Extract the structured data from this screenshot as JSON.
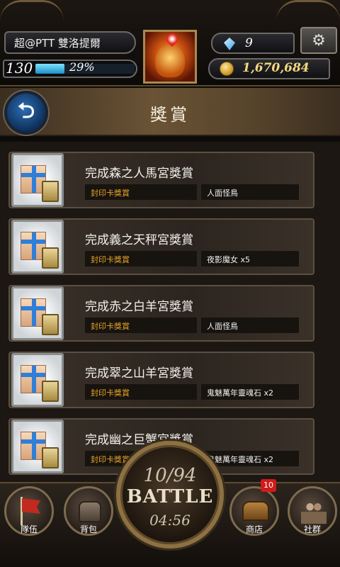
{
  "header": {
    "player_name": "超@PTT 雙洛提爾",
    "level": "130",
    "exp_percent": "29%",
    "exp_fraction": 0.29,
    "gems": "9",
    "coins": "1,670,684",
    "avatar_icon": "fire-lion-avatar",
    "settings_icon": "gears-icon"
  },
  "title_bar": {
    "back_icon": "back-arrow-icon",
    "title": "獎賞"
  },
  "rewards": [
    {
      "name": "完成森之人馬宮獎賞",
      "type": "封印卡獎賞",
      "item": "人面怪鳥"
    },
    {
      "name": "完成義之天秤宮獎賞",
      "type": "封印卡獎賞",
      "item": "夜影魔女 x5"
    },
    {
      "name": "完成赤之白羊宮獎賞",
      "type": "封印卡獎賞",
      "item": "人面怪鳥"
    },
    {
      "name": "完成翠之山羊宮獎賞",
      "type": "封印卡獎賞",
      "item": "鬼魅萬年靈魂石 x2"
    },
    {
      "name": "完成幽之巨蟹宮獎賞",
      "type": "封印卡獎賞",
      "item": "鬼魅萬年靈魂石 x2"
    }
  ],
  "bottom_nav": {
    "team": "隊伍",
    "bag": "背包",
    "shop": "商店",
    "shop_badge": "10",
    "community": "社群",
    "battle_count": "10/94",
    "battle_label": "BATTLE",
    "battle_timer": "04:56"
  },
  "colors": {
    "accent_gold": "#e9a627",
    "exp_blue": "#1b8fc8",
    "badge_red": "#d11a1a"
  }
}
